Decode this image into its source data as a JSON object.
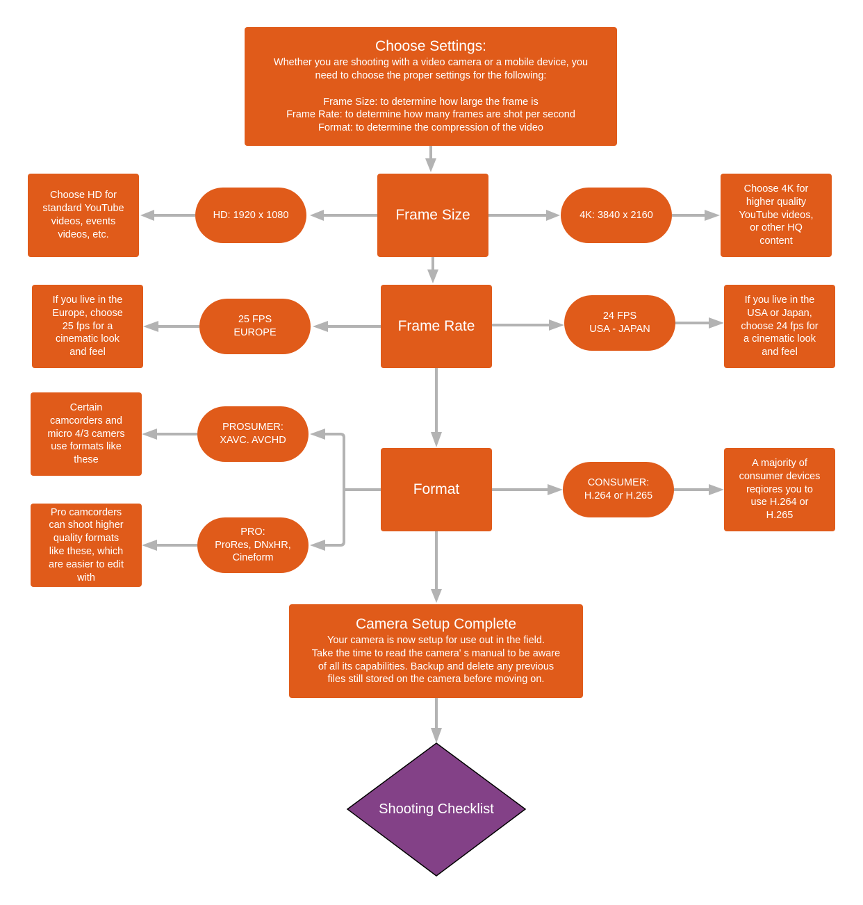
{
  "colors": {
    "node_fill": "#e05b1a",
    "node_text": "#ffffff",
    "connector": "#b3b3b3",
    "decision_fill": "#834187",
    "decision_stroke": "#000000"
  },
  "nodes": {
    "choose_settings": {
      "title": "Choose Settings:",
      "body": "Whether you are shooting with a video camera or a mobile device, you\nneed to choose the proper settings for the following:\n\nFrame Size: to determine how large the frame is\nFrame Rate: to determine how many frames are shot per second\nFormat: to determine the compression of the video"
    },
    "frame_size": {
      "label": "Frame Size"
    },
    "hd": {
      "label": "HD: 1920 x 1080"
    },
    "hd_note": {
      "label": "Choose HD for\nstandard YouTube\nvideos, events\nvideos, etc."
    },
    "4k": {
      "label": "4K: 3840 x 2160"
    },
    "4k_note": {
      "label": "Choose 4K for\nhigher quality\nYouTube videos,\nor other HQ\ncontent"
    },
    "frame_rate": {
      "label": "Frame Rate"
    },
    "fps25": {
      "label": "25 FPS\nEUROPE"
    },
    "fps25_note": {
      "label": "If you live in the\nEurope, choose\n25 fps for a\ncinematic look\nand feel"
    },
    "fps24": {
      "label": "24 FPS\nUSA - JAPAN"
    },
    "fps24_note": {
      "label": "If you live in the\nUSA or Japan,\nchoose 24 fps for\na cinematic look\nand feel"
    },
    "format": {
      "label": "Format"
    },
    "prosumer": {
      "label": "PROSUMER:\nXAVC. AVCHD"
    },
    "prosumer_note": {
      "label": "Certain\ncamcorders and\nmicro 4/3 camers\nuse formats like\nthese"
    },
    "pro": {
      "label": "PRO:\nProRes, DNxHR,\nCineform"
    },
    "pro_note": {
      "label": "Pro camcorders\ncan shoot higher\nquality formats\nlike these, which\nare easier to edit\nwith"
    },
    "consumer": {
      "label": "CONSUMER:\nH.264 or H.265"
    },
    "consumer_note": {
      "label": "A majority of\nconsumer devices\nreqiores you to\nuse H.264 or\nH.265"
    },
    "setup_complete": {
      "title": "Camera Setup Complete",
      "body": "Your camera is now setup for use out in the field.\nTake the time to read the camera' s manual to be aware\nof all its capabilities. Backup and delete any previous\nfiles still stored on the camera before moving on."
    },
    "shooting_checklist": {
      "label": "Shooting Checklist"
    }
  }
}
